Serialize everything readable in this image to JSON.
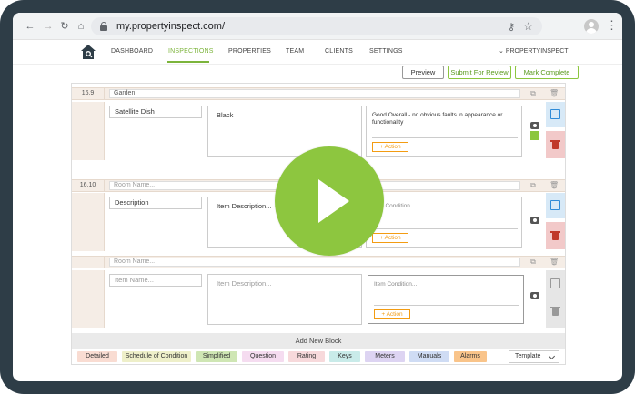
{
  "browser": {
    "url": "my.propertyinspect.com/"
  },
  "nav": {
    "items": [
      "DASHBOARD",
      "INSPECTIONS",
      "PROPERTIES",
      "TEAM",
      "CLIENTS",
      "SETTINGS"
    ],
    "active": "INSPECTIONS",
    "user": "PROPERTYINSPECT"
  },
  "toolbar": {
    "preview_label": "Preview",
    "submit_label": "Submit For Review",
    "complete_label": "Mark Complete"
  },
  "rooms": [
    {
      "number": "16.9",
      "room_name": "Garden",
      "item_name": "Satellite Dish",
      "description": "Black",
      "condition": "Good Overall - no obvious faults in appearance or functionality",
      "action_label": "+ Action"
    },
    {
      "number": "16.10",
      "room_placeholder": "Room Name...",
      "item_name": "Description",
      "description_placeholder": "Item Description...",
      "condition_placeholder": "Item Condition...",
      "action_label": "+ Action"
    },
    {
      "number": "",
      "room_placeholder": "Room Name...",
      "item_placeholder": "Item Name...",
      "description_placeholder": "Item Description...",
      "condition_placeholder": "Item Condition...",
      "action_label": "+ Action"
    }
  ],
  "add_block_label": "Add New Block",
  "block_types": [
    {
      "label": "Detailed",
      "color": "#f9dcd2"
    },
    {
      "label": "Schedule of Condition",
      "color": "#eeefc9"
    },
    {
      "label": "Simplified",
      "color": "#cfe6b4"
    },
    {
      "label": "Question",
      "color": "#f5dcf0"
    },
    {
      "label": "Rating",
      "color": "#f7d9db"
    },
    {
      "label": "Keys",
      "color": "#c9ebe9"
    },
    {
      "label": "Meters",
      "color": "#ddd4f2"
    },
    {
      "label": "Manuals",
      "color": "#cfdcf4"
    },
    {
      "label": "Alarms",
      "color": "#f9c48a"
    }
  ],
  "template_label": "Template",
  "colors": {
    "accent": "#7cb43b",
    "play_button": "#8dc63f",
    "action": "#f39c12",
    "delete": "#c0392b",
    "copy": "#2e8bd8"
  },
  "icons": [
    "back-icon",
    "forward-icon",
    "reload-icon",
    "home-icon",
    "lock-icon",
    "key-icon",
    "star-icon",
    "avatar",
    "menu-icon",
    "house-logo",
    "camera-icon",
    "copy-icon",
    "trash-icon",
    "chevron-down-icon",
    "play-icon"
  ]
}
